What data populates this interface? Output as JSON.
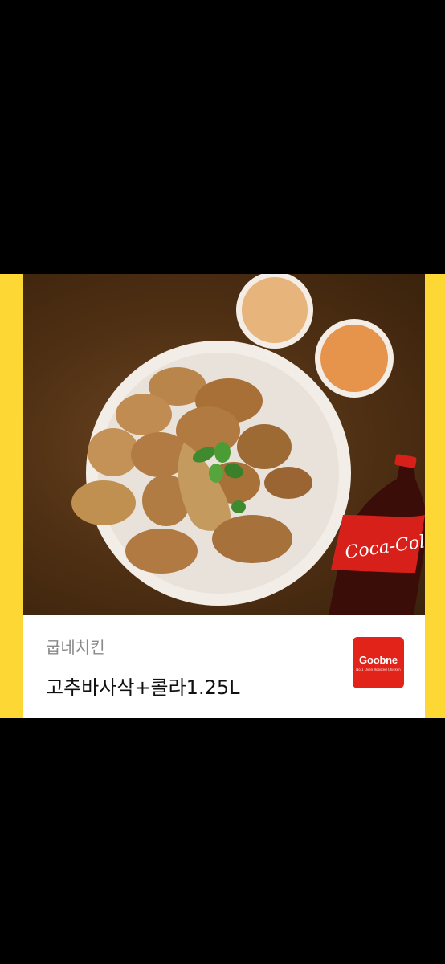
{
  "product": {
    "brand_name": "굽네치킨",
    "title": "고추바사삭+콜라1.25L"
  },
  "logo": {
    "text": "Goobne",
    "tagline": "No.1 Oven Roasted Chicken",
    "color": "#e2231a"
  },
  "image": {
    "icon": "chicken-platter-photo",
    "bottle_label": "Coca-Cola"
  },
  "colors": {
    "background": "#000000",
    "accent_band": "#fdd835"
  }
}
